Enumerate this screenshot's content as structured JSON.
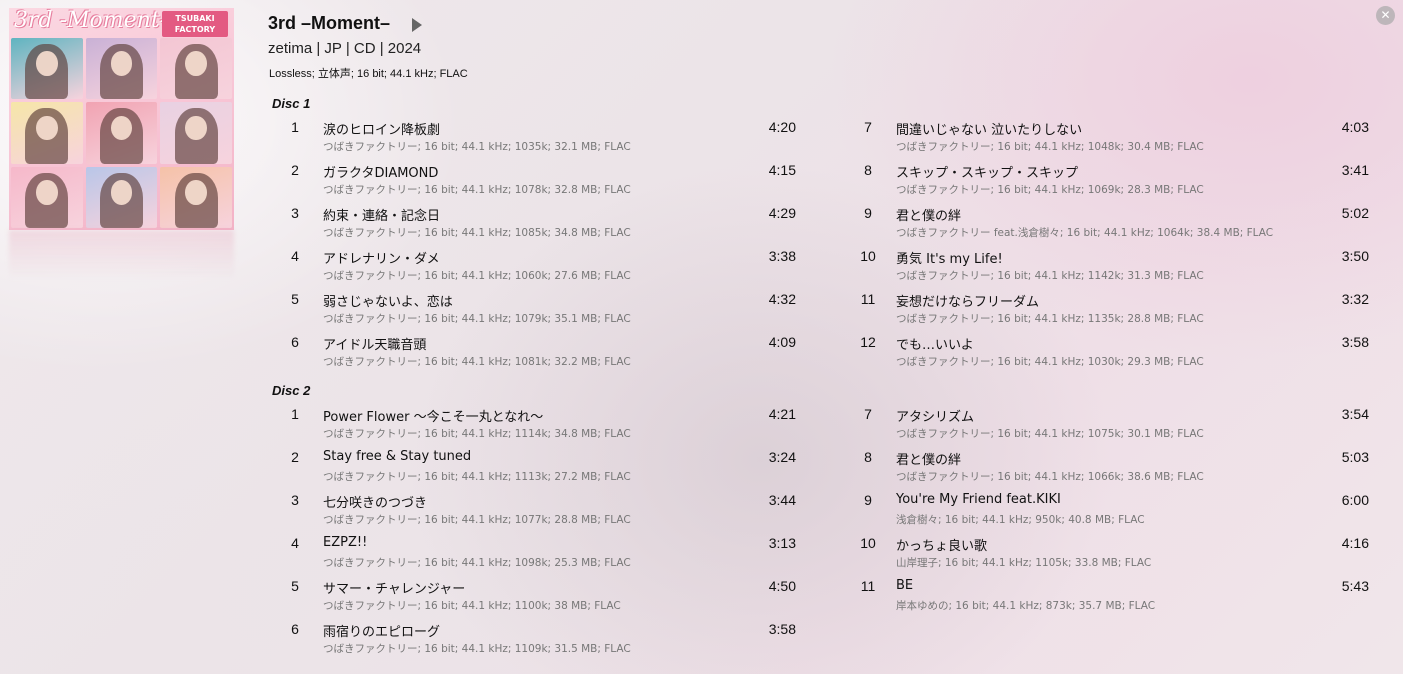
{
  "cover": {
    "title": "3rd -Moment-",
    "brand": "TSUBAKI FACTORY",
    "cell_colors": [
      "#5fb4c0",
      "#c9b1d6",
      "#f3c6d3",
      "#f6e6a8",
      "#f1a3b2",
      "#e8d1e2",
      "#f6b8ca",
      "#b9c6e8",
      "#f5c2a8"
    ]
  },
  "album": {
    "title": "3rd –Moment–",
    "meta": "zetima | JP | CD | 2024",
    "format": "Lossless; 立体声; 16 bit; 44.1 kHz; FLAC"
  },
  "discs": [
    {
      "label": "Disc 1",
      "left": [
        {
          "num": "1",
          "title": "涙のヒロイン降板劇",
          "duration": "4:20",
          "info": "つばきファクトリー; 16 bit; 44.1 kHz; 1035k; 32.1 MB; FLAC"
        },
        {
          "num": "2",
          "title": "ガラクタDIAMOND",
          "duration": "4:15",
          "info": "つばきファクトリー; 16 bit; 44.1 kHz; 1078k; 32.8 MB; FLAC"
        },
        {
          "num": "3",
          "title": "約束・連絡・記念日",
          "duration": "4:29",
          "info": "つばきファクトリー; 16 bit; 44.1 kHz; 1085k; 34.8 MB; FLAC"
        },
        {
          "num": "4",
          "title": "アドレナリン・ダメ",
          "duration": "3:38",
          "info": "つばきファクトリー; 16 bit; 44.1 kHz; 1060k; 27.6 MB; FLAC"
        },
        {
          "num": "5",
          "title": "弱さじゃないよ、恋は",
          "duration": "4:32",
          "info": "つばきファクトリー; 16 bit; 44.1 kHz; 1079k; 35.1 MB; FLAC"
        },
        {
          "num": "6",
          "title": "アイドル天職音頭",
          "duration": "4:09",
          "info": "つばきファクトリー; 16 bit; 44.1 kHz; 1081k; 32.2 MB; FLAC"
        }
      ],
      "right": [
        {
          "num": "7",
          "title": "間違いじゃない 泣いたりしない",
          "duration": "4:03",
          "info": "つばきファクトリー; 16 bit; 44.1 kHz; 1048k; 30.4 MB; FLAC"
        },
        {
          "num": "8",
          "title": "スキップ・スキップ・スキップ",
          "duration": "3:41",
          "info": "つばきファクトリー; 16 bit; 44.1 kHz; 1069k; 28.3 MB; FLAC"
        },
        {
          "num": "9",
          "title": "君と僕の絆",
          "duration": "5:02",
          "info": "つばきファクトリー feat.浅倉樹々; 16 bit; 44.1 kHz; 1064k; 38.4 MB; FLAC"
        },
        {
          "num": "10",
          "title": "勇気 It's my Life!",
          "duration": "3:50",
          "info": "つばきファクトリー; 16 bit; 44.1 kHz; 1142k; 31.3 MB; FLAC"
        },
        {
          "num": "11",
          "title": "妄想だけならフリーダム",
          "duration": "3:32",
          "info": "つばきファクトリー; 16 bit; 44.1 kHz; 1135k; 28.8 MB; FLAC"
        },
        {
          "num": "12",
          "title": "でも…いいよ",
          "duration": "3:58",
          "info": "つばきファクトリー; 16 bit; 44.1 kHz; 1030k; 29.3 MB; FLAC"
        }
      ]
    },
    {
      "label": "Disc 2",
      "left": [
        {
          "num": "1",
          "title": "Power Flower 〜今こそ一丸となれ〜",
          "duration": "4:21",
          "info": "つばきファクトリー; 16 bit; 44.1 kHz; 1114k; 34.8 MB; FLAC"
        },
        {
          "num": "2",
          "title": "Stay free & Stay tuned",
          "duration": "3:24",
          "info": "つばきファクトリー; 16 bit; 44.1 kHz; 1113k; 27.2 MB; FLAC"
        },
        {
          "num": "3",
          "title": "七分咲きのつづき",
          "duration": "3:44",
          "info": "つばきファクトリー; 16 bit; 44.1 kHz; 1077k; 28.8 MB; FLAC"
        },
        {
          "num": "4",
          "title": "EZPZ!!",
          "duration": "3:13",
          "info": "つばきファクトリー; 16 bit; 44.1 kHz; 1098k; 25.3 MB; FLAC"
        },
        {
          "num": "5",
          "title": "サマー・チャレンジャー",
          "duration": "4:50",
          "info": "つばきファクトリー; 16 bit; 44.1 kHz; 1100k; 38 MB; FLAC"
        },
        {
          "num": "6",
          "title": "雨宿りのエピローグ",
          "duration": "3:58",
          "info": "つばきファクトリー; 16 bit; 44.1 kHz; 1109k; 31.5 MB; FLAC"
        }
      ],
      "right": [
        {
          "num": "7",
          "title": "アタシリズム",
          "duration": "3:54",
          "info": "つばきファクトリー; 16 bit; 44.1 kHz; 1075k; 30.1 MB; FLAC"
        },
        {
          "num": "8",
          "title": "君と僕の絆",
          "duration": "5:03",
          "info": "つばきファクトリー; 16 bit; 44.1 kHz; 1066k; 38.6 MB; FLAC"
        },
        {
          "num": "9",
          "title": "You're My Friend feat.KIKI",
          "duration": "6:00",
          "info": "浅倉樹々; 16 bit; 44.1 kHz; 950k; 40.8 MB; FLAC"
        },
        {
          "num": "10",
          "title": "かっちょ良い歌",
          "duration": "4:16",
          "info": "山岸理子; 16 bit; 44.1 kHz; 1105k; 33.8 MB; FLAC"
        },
        {
          "num": "11",
          "title": "BE",
          "duration": "5:43",
          "info": "岸本ゆめの; 16 bit; 44.1 kHz; 873k; 35.7 MB; FLAC"
        }
      ]
    }
  ],
  "icons": {
    "play": "play-icon",
    "close": "close-icon",
    "close_glyph": "✕"
  }
}
